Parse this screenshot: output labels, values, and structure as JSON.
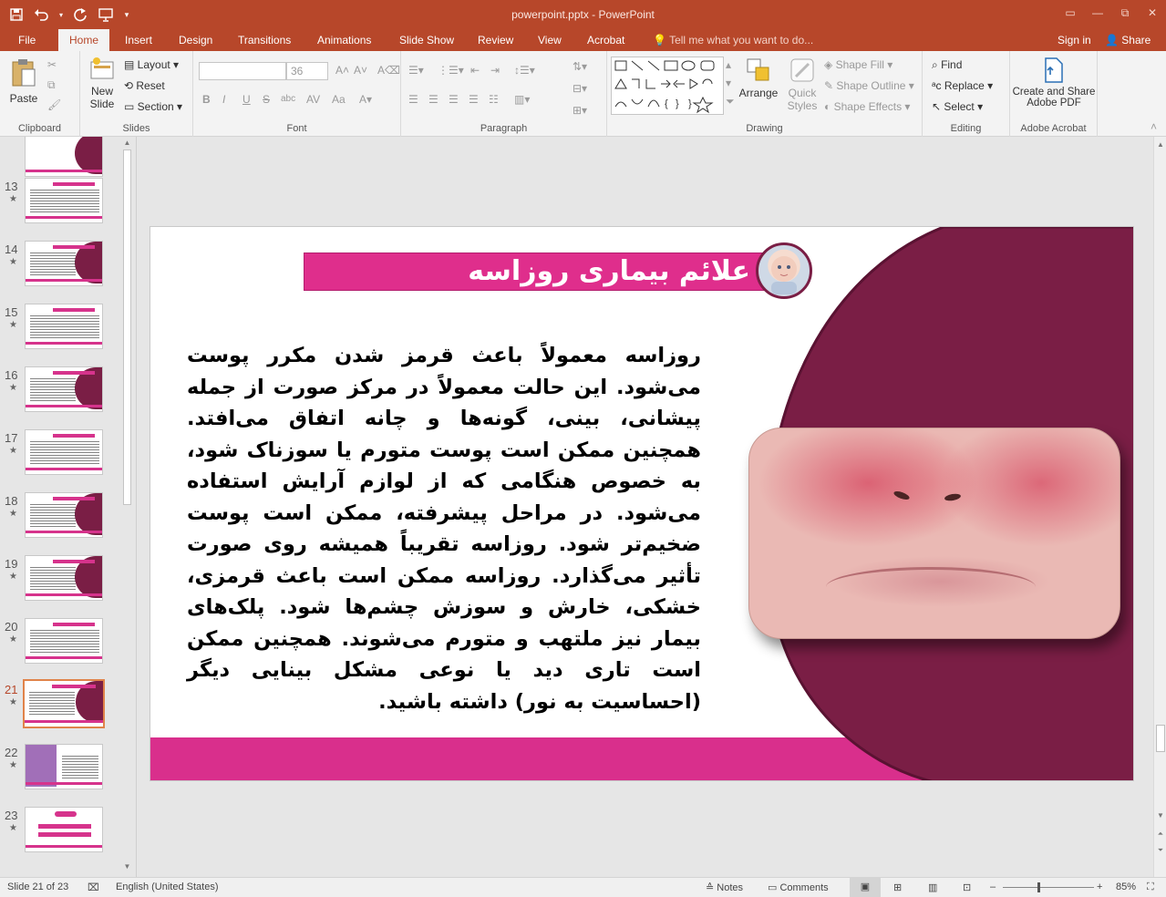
{
  "window": {
    "title": "powerpoint.pptx - PowerPoint",
    "controls": [
      "▭",
      "—",
      "⧉",
      "✕"
    ]
  },
  "qat": {
    "save_icon": "save-icon",
    "undo_icon": "undo-icon",
    "redo_icon": "redo-icon",
    "present_icon": "present-icon",
    "customize_icon": "customize-icon"
  },
  "tabs": [
    "File",
    "Home",
    "Insert",
    "Design",
    "Transitions",
    "Animations",
    "Slide Show",
    "Review",
    "View",
    "Acrobat"
  ],
  "active_tab": "Home",
  "tell_me": "Tell me what you want to do...",
  "sign_in": "Sign in",
  "share": "Share",
  "ribbon": {
    "clipboard": {
      "label": "Clipboard",
      "paste": "Paste"
    },
    "slides": {
      "label": "Slides",
      "new_slide_1": "New",
      "new_slide_2": "Slide",
      "layout": "Layout",
      "reset": "Reset",
      "section": "Section"
    },
    "font": {
      "label": "Font",
      "font_name": "",
      "font_size": "36",
      "bold": "B",
      "italic": "I",
      "underline": "U",
      "strike": "S",
      "spacing": "abc",
      "aa": "Aa"
    },
    "paragraph": {
      "label": "Paragraph"
    },
    "drawing": {
      "label": "Drawing",
      "arrange": "Arrange",
      "quick_styles_1": "Quick",
      "quick_styles_2": "Styles",
      "shape_fill": "Shape Fill",
      "shape_outline": "Shape Outline",
      "shape_effects": "Shape Effects"
    },
    "editing": {
      "label": "Editing",
      "find": "Find",
      "replace": "Replace",
      "select": "Select"
    },
    "acrobat": {
      "label": "Adobe Acrobat",
      "create_1": "Create and Share",
      "create_2": "Adobe PDF"
    }
  },
  "thumbnails": [
    {
      "num": "13",
      "current": false
    },
    {
      "num": "14",
      "current": false
    },
    {
      "num": "15",
      "current": false
    },
    {
      "num": "16",
      "current": false
    },
    {
      "num": "17",
      "current": false
    },
    {
      "num": "18",
      "current": false
    },
    {
      "num": "19",
      "current": false
    },
    {
      "num": "20",
      "current": false
    },
    {
      "num": "21",
      "current": true
    },
    {
      "num": "22",
      "current": false
    },
    {
      "num": "23",
      "current": false
    }
  ],
  "slide": {
    "title": "علائم بیماری روزاسه",
    "body": "روزاسه معمولاً باعث قرمز شدن مکرر پوست می‌شود. این حالت معمولاً در مرکز صورت از جمله پیشانی، بینی، گونه‌ها و چانه اتفاق می‌افتد. همچنین ممکن است پوست متورم یا سوزناک شود، به خصوص هنگامی که از لوازم آرایش استفاده می‌شود. در مراحل پیشرفته، ممکن است پوست ضخیم‌تر شود. روزاسه تقریباً همیشه روی صورت تأثیر می‌گذارد. روزاسه ممکن است باعث قرمزی، خشکی، خارش و سوزش چشم‌ها شود. پلک‌های بیمار نیز ملتهب و متورم می‌شوند. همچنین ممکن است تاری دید یا نوعی مشکل بینایی دیگر (احساسیت به نور) داشته باشید."
  },
  "status": {
    "slide_of": "Slide 21 of 23",
    "language": "English (United States)",
    "notes": "Notes",
    "comments": "Comments",
    "zoom": "85%",
    "minus": "–",
    "plus": "+"
  },
  "colors": {
    "accent": "#b7472a",
    "pink": "#d92f8c",
    "maroon": "#7a1e45"
  }
}
